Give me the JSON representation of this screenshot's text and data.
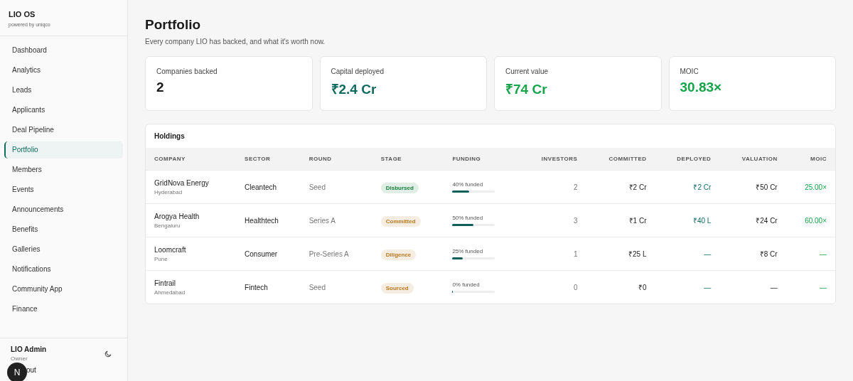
{
  "brand": {
    "title": "LIO OS",
    "subtitle": "powered by uniqco"
  },
  "nav": [
    {
      "label": "Dashboard",
      "selected": false
    },
    {
      "label": "Analytics",
      "selected": false
    },
    {
      "label": "Leads",
      "selected": false
    },
    {
      "label": "Applicants",
      "selected": false
    },
    {
      "label": "Deal Pipeline",
      "selected": false
    },
    {
      "label": "Portfolio",
      "selected": true
    },
    {
      "label": "Members",
      "selected": false
    },
    {
      "label": "Events",
      "selected": false
    },
    {
      "label": "Announcements",
      "selected": false
    },
    {
      "label": "Benefits",
      "selected": false
    },
    {
      "label": "Galleries",
      "selected": false
    },
    {
      "label": "Notifications",
      "selected": false
    },
    {
      "label": "Community App",
      "selected": false
    },
    {
      "label": "Finance",
      "selected": false
    }
  ],
  "user": {
    "name": "LIO Admin",
    "role": "Owner",
    "sign_out": "out",
    "badge": "N"
  },
  "page": {
    "title": "Portfolio",
    "subtitle": "Every company LIO has backed, and what it's worth now."
  },
  "stats": [
    {
      "label": "Companies backed",
      "value": "2",
      "color": "#1a1a1a"
    },
    {
      "label": "Capital deployed",
      "value": "₹2.4 Cr",
      "color": "#0f6b5e"
    },
    {
      "label": "Current value",
      "value": "₹74 Cr",
      "color": "#16a34a"
    },
    {
      "label": "MOIC",
      "value": "30.83×",
      "color": "#16a34a"
    }
  ],
  "holdings": {
    "title": "Holdings",
    "columns": [
      "COMPANY",
      "SECTOR",
      "ROUND",
      "STAGE",
      "FUNDING",
      "INVESTORS",
      "COMMITTED",
      "DEPLOYED",
      "VALUATION",
      "MOIC"
    ],
    "rows": [
      {
        "company": "GridNova Energy",
        "city": "Hyderabad",
        "sector": "Cleantech",
        "round": "Seed",
        "stage": {
          "label": "Disbursed",
          "color": "#15803d"
        },
        "funding": "40% funded",
        "level": 0.4,
        "investors": "2",
        "committed": "₹2 Cr",
        "deployed": "₹2 Cr",
        "valuation": "₹50 Cr",
        "moic": "25.00×"
      },
      {
        "company": "Arogya Health",
        "city": "Bengaluru",
        "sector": "Healthtech",
        "round": "Series A",
        "stage": {
          "label": "Committed",
          "color": "#b7791f"
        },
        "funding": "50% funded",
        "level": 0.5,
        "investors": "3",
        "committed": "₹1 Cr",
        "deployed": "₹40 L",
        "valuation": "₹24 Cr",
        "moic": "60.00×"
      },
      {
        "company": "Loomcraft",
        "city": "Pune",
        "sector": "Consumer",
        "round": "Pre-Series A",
        "stage": {
          "label": "Diligence",
          "color": "#b7791f"
        },
        "funding": "25% funded",
        "level": 0.25,
        "investors": "1",
        "committed": "₹25 L",
        "deployed": "—",
        "valuation": "₹8 Cr",
        "moic": "—"
      },
      {
        "company": "Fintrail",
        "city": "Ahmedabad",
        "sector": "Fintech",
        "round": "Seed",
        "stage": {
          "label": "Sourced",
          "color": "#b7791f"
        },
        "funding": "0% funded",
        "level": 0,
        "investors": "0",
        "committed": "₹0",
        "deployed": "—",
        "valuation": "—",
        "moic": "—"
      }
    ]
  }
}
